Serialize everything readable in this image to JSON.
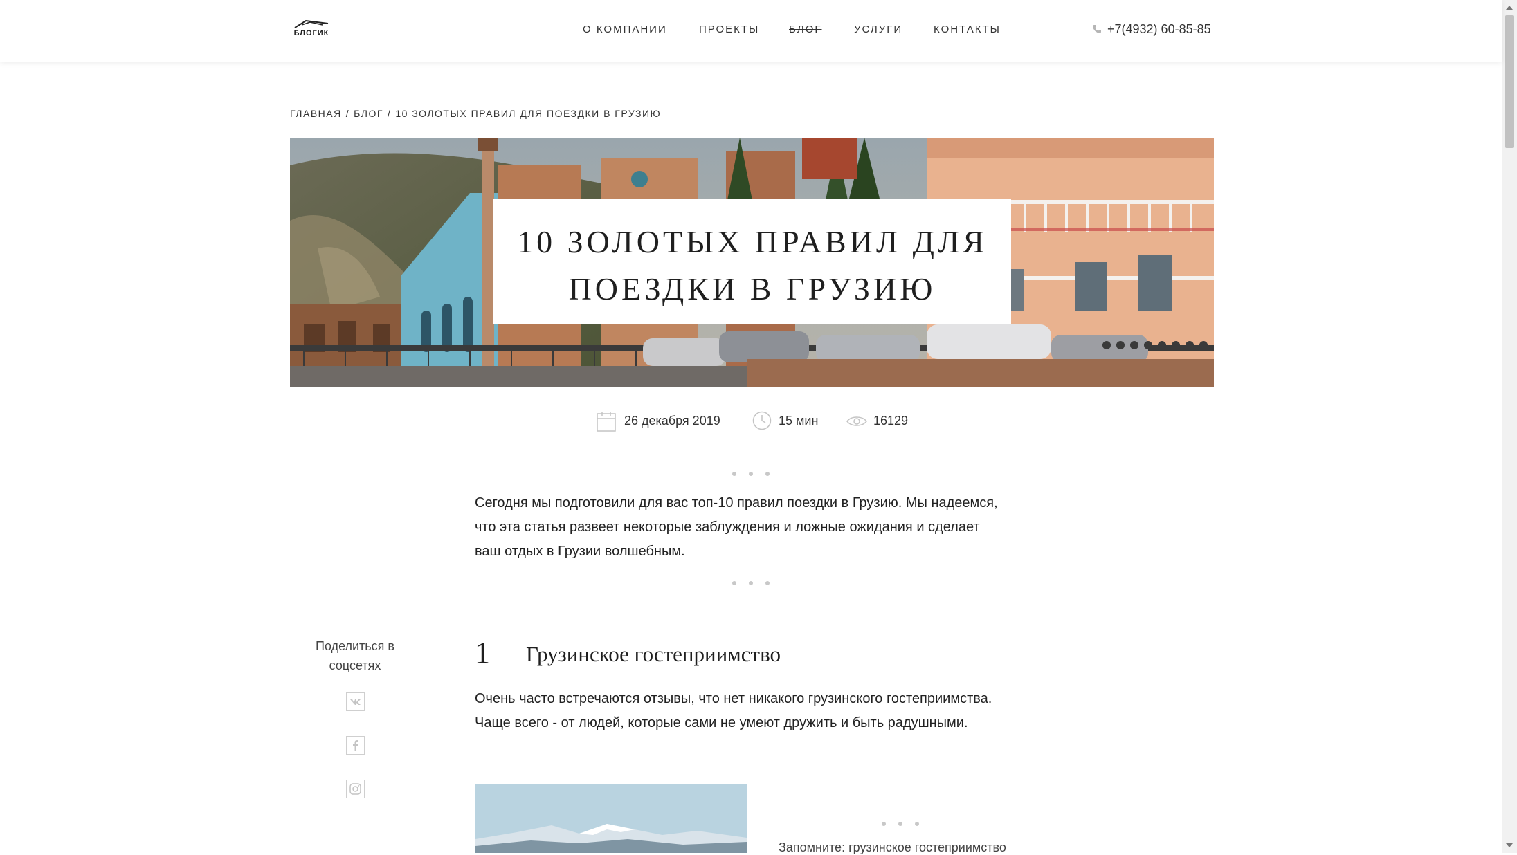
{
  "header": {
    "logo_text": "БЛОГИК",
    "nav": [
      "О КОМПАНИИ",
      "ПРОЕКТЫ",
      "БЛОГ",
      "УСЛУГИ",
      "КОНТАКТЫ"
    ],
    "active_nav": "БЛОГ",
    "phone": "+7(4932) 60-85-85",
    "phone_icon": "phone-icon"
  },
  "breadcrumb": {
    "items": [
      "ГЛАВНАЯ",
      "БЛОГ",
      "10 ЗОЛОТЫХ ПРАВИЛ ДЛЯ ПОЕЗДКИ В ГРУЗИЮ"
    ],
    "separator": "/"
  },
  "hero": {
    "title_line1": "10 ЗОЛОТЫХ ПРАВИЛ ДЛЯ",
    "title_line2": "ПОЕЗДКИ В ГРУЗИЮ"
  },
  "meta": {
    "date": "26 декабря 2019",
    "read_time": "15 мин",
    "views": "16129",
    "icons": [
      "calendar-icon",
      "clock-icon",
      "eye-icon"
    ]
  },
  "intro": "Сегодня мы подготовили для вас топ-10 правил поездки в Грузию. Мы надеемся, что эта статья развеет некоторые заблуждения и ложные ожидания и сделает ваш отдых в Грузии волшебным.",
  "share": {
    "label": "Поделиться в соцсетях",
    "icons": [
      "vk-icon",
      "facebook-icon",
      "instagram-icon"
    ]
  },
  "section": {
    "number": "1",
    "title": "Грузинское гостеприимство",
    "text": "Очень часто встречаются отзывы, что нет никакого грузинского гостеприимства. Чаще всего - от людей, которые сами не умеют дружить и быть радушными."
  },
  "quote_preview": "Запомните: грузинское гостеприимство",
  "colors": {
    "accent_text": "#1f1f1f",
    "dots": "#c8c8c8",
    "icon_gray": "#c4c4c4"
  }
}
